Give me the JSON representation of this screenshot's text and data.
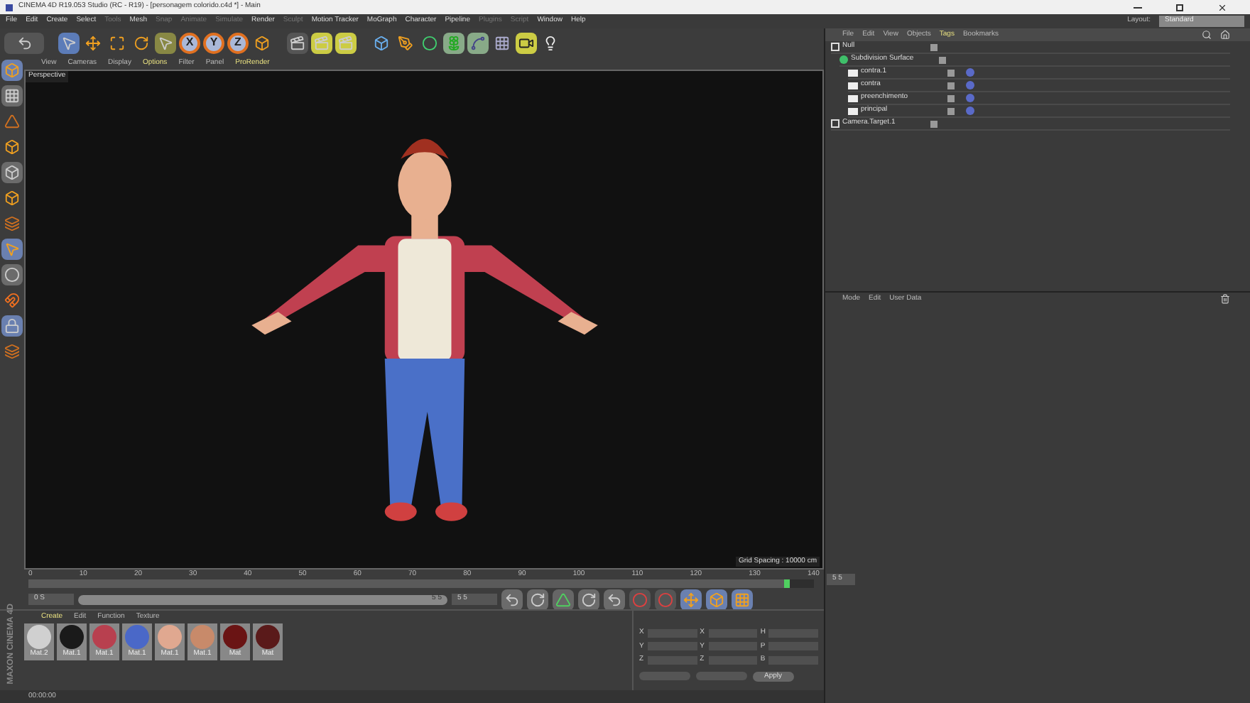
{
  "window": {
    "title": "CINEMA 4D R19.053 Studio (RC - R19) - [personagem colorido.c4d *] - Main"
  },
  "menu": [
    {
      "label": "File",
      "disabled": false
    },
    {
      "label": "Edit",
      "disabled": false
    },
    {
      "label": "Create",
      "disabled": false
    },
    {
      "label": "Select",
      "disabled": false
    },
    {
      "label": "Tools",
      "disabled": true
    },
    {
      "label": "Mesh",
      "disabled": false
    },
    {
      "label": "Snap",
      "disabled": true
    },
    {
      "label": "Animate",
      "disabled": true
    },
    {
      "label": "Simulate",
      "disabled": true
    },
    {
      "label": "Render",
      "disabled": false
    },
    {
      "label": "Sculpt",
      "disabled": true
    },
    {
      "label": "Motion Tracker",
      "disabled": false
    },
    {
      "label": "MoGraph",
      "disabled": false
    },
    {
      "label": "Character",
      "disabled": false
    },
    {
      "label": "Pipeline",
      "disabled": false
    },
    {
      "label": "Plugins",
      "disabled": true
    },
    {
      "label": "Script",
      "disabled": true
    },
    {
      "label": "Window",
      "disabled": false
    },
    {
      "label": "Help",
      "disabled": false
    }
  ],
  "layout": {
    "label": "Layout:",
    "value": "Standard"
  },
  "axes": [
    "X",
    "Y",
    "Z"
  ],
  "viewport": {
    "menu": [
      {
        "label": "View",
        "highlighted": false
      },
      {
        "label": "Cameras",
        "highlighted": false
      },
      {
        "label": "Display",
        "highlighted": false
      },
      {
        "label": "Options",
        "highlighted": true
      },
      {
        "label": "Filter",
        "highlighted": false
      },
      {
        "label": "Panel",
        "highlighted": false
      },
      {
        "label": "ProRender",
        "highlighted": true
      }
    ],
    "camera": "Perspective",
    "grid_spacing": "Grid Spacing : 10000 cm"
  },
  "object_manager": {
    "menu": [
      {
        "label": "File",
        "highlighted": false
      },
      {
        "label": "Edit",
        "highlighted": false
      },
      {
        "label": "View",
        "highlighted": false
      },
      {
        "label": "Objects",
        "highlighted": false
      },
      {
        "label": "Tags",
        "highlighted": true
      },
      {
        "label": "Bookmarks",
        "highlighted": false
      }
    ],
    "objects": [
      {
        "name": "Null",
        "kind": "null",
        "material": false,
        "children": [
          {
            "name": "Subdivision Surface",
            "kind": "subdivision",
            "material": false,
            "children": [
              {
                "name": "contra.1",
                "kind": "polygon",
                "material": true
              },
              {
                "name": "contra",
                "kind": "polygon",
                "material": true
              },
              {
                "name": "preenchimento",
                "kind": "polygon",
                "material": true
              },
              {
                "name": "principal",
                "kind": "polygon",
                "material": true
              }
            ]
          }
        ]
      },
      {
        "name": "Camera.Target.1",
        "kind": "null",
        "material": false
      }
    ]
  },
  "attributes": {
    "menu": [
      "Mode",
      "Edit",
      "User Data"
    ]
  },
  "timeline": {
    "ticks": [
      "0",
      "10",
      "20",
      "30",
      "40",
      "50",
      "60",
      "70",
      "80",
      "90",
      "100",
      "110",
      "120",
      "130",
      "140"
    ],
    "current_frame": "5 5",
    "start": "0 S",
    "range": {
      "label": "5 5",
      "level": 1
    },
    "end": "5 5",
    "level": 0.97
  },
  "materials": {
    "menu": [
      {
        "label": "Create",
        "highlighted": true
      },
      {
        "label": "Edit",
        "highlighted": false
      },
      {
        "label": "Function",
        "highlighted": false
      },
      {
        "label": "Texture",
        "highlighted": false
      }
    ],
    "items": [
      {
        "name": "Mat.2",
        "color": "#d0d0d0"
      },
      {
        "name": "Mat.1",
        "color": "#1a1a1a"
      },
      {
        "name": "Mat.1",
        "color": "#b8404f"
      },
      {
        "name": "Mat.1",
        "color": "#4a68c8"
      },
      {
        "name": "Mat.1",
        "color": "#e0a890"
      },
      {
        "name": "Mat.1",
        "color": "#c88a6a"
      },
      {
        "name": "Mat",
        "color": "#6a1414"
      },
      {
        "name": "Mat",
        "color": "#5a1a1a"
      }
    ]
  },
  "coordinates": {
    "rows": [
      {
        "a": "X",
        "b": "X",
        "c": "H"
      },
      {
        "a": "Y",
        "b": "Y",
        "c": "P"
      },
      {
        "a": "Z",
        "b": "Z",
        "c": "B"
      }
    ],
    "apply": "Apply"
  },
  "brand": "MAXON CINEMA 4D",
  "status_bar": {
    "time": "00:00:00"
  }
}
